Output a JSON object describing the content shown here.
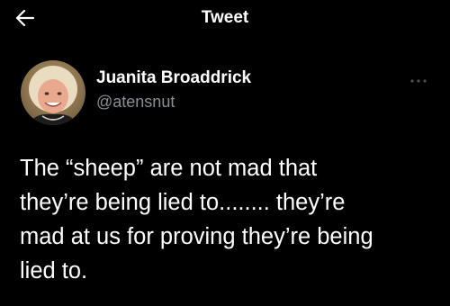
{
  "header": {
    "title": "Tweet",
    "back_icon": "arrow-left-icon"
  },
  "tweet": {
    "author": {
      "display_name": "Juanita Broaddrick",
      "handle": "@atensnut"
    },
    "more_icon": "more-horizontal-icon",
    "text_lines": [
      "The “sheep” are not mad that",
      "they’re being lied to........ they’re",
      "mad at us for proving they’re being",
      "lied to."
    ]
  },
  "colors": {
    "background": "#000000",
    "primary_text": "#ffffff",
    "secondary_text": "#8a8f94"
  }
}
